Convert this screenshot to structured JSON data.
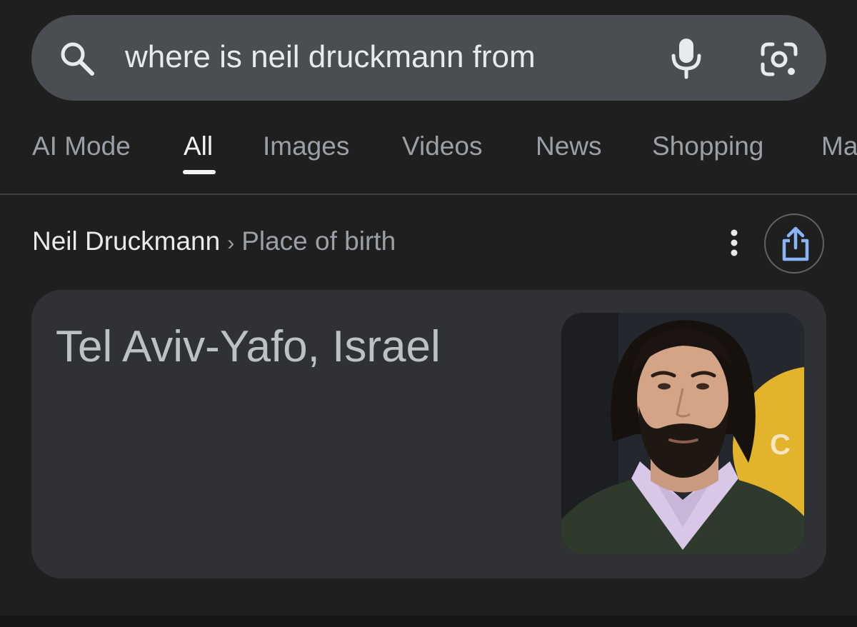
{
  "search": {
    "query": "where is neil druckmann from",
    "icons": {
      "search": "search-icon",
      "voice": "mic-icon",
      "lens": "google-lens-icon"
    }
  },
  "tabs": [
    {
      "label": "AI Mode",
      "active": false
    },
    {
      "label": "All",
      "active": true
    },
    {
      "label": "Images",
      "active": false
    },
    {
      "label": "Videos",
      "active": false
    },
    {
      "label": "News",
      "active": false
    },
    {
      "label": "Shopping",
      "active": false
    },
    {
      "label": "Ma",
      "active": false
    }
  ],
  "breadcrumb": {
    "entity": "Neil Druckmann",
    "separator": "›",
    "attribute": "Place of birth",
    "icons": {
      "more": "more-vert-icon",
      "share": "share-icon"
    }
  },
  "answer": {
    "value": "Tel Aviv-Yafo, Israel",
    "photo": "portrait-photo"
  },
  "colors": {
    "background": "#1f1f1f",
    "search_bar": "#4a4d52",
    "card": "#303134",
    "share_accent": "#8ab4f8"
  }
}
